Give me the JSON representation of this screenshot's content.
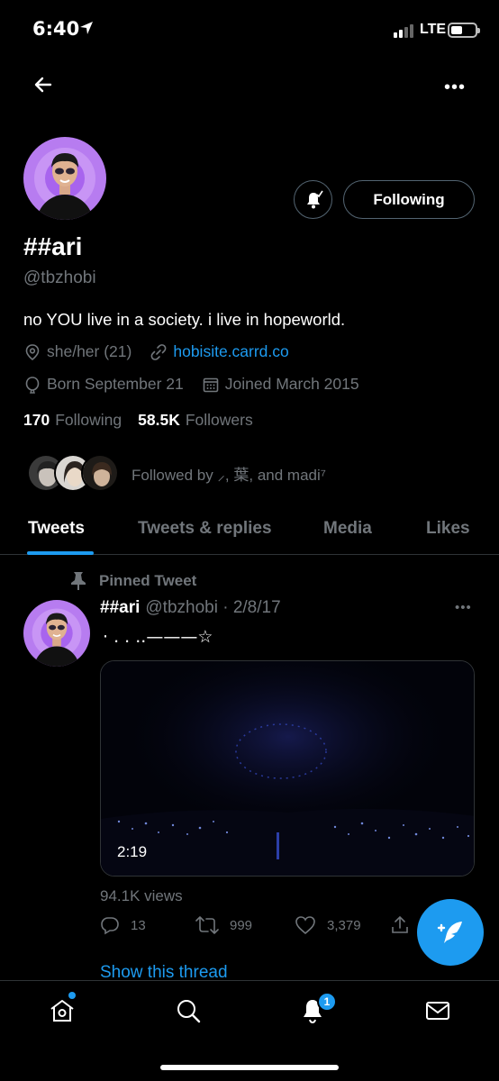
{
  "status_bar": {
    "time": "6:40",
    "network": "LTE"
  },
  "profile": {
    "display_name": "##ari",
    "handle": "@tbzhobi",
    "bio": "no YOU live in a society. i live in hopeworld.",
    "pronouns": "she/her (21)",
    "website": "hobisite.carrd.co",
    "birthday": "Born September 21",
    "joined": "Joined March 2015",
    "following_count": "170",
    "following_label": "Following",
    "followers_count": "58.5K",
    "followers_label": "Followers",
    "followed_by": "Followed by ⸝, 葉, and  madi⁷",
    "follow_button": "Following"
  },
  "tabs": [
    {
      "label": "Tweets",
      "active": true
    },
    {
      "label": "Tweets & replies",
      "active": false
    },
    {
      "label": "Media",
      "active": false
    },
    {
      "label": "Likes",
      "active": false
    }
  ],
  "pinned_tweet": {
    "pinned_label": "Pinned Tweet",
    "author_name": "##ari",
    "author_meta": "@tbzhobi · 2/8/17",
    "text": "· . . ..———☆",
    "video_duration": "2:19",
    "views": "94.1K views",
    "replies": "13",
    "retweets": "999",
    "likes": "3,379",
    "show_thread": "Show this thread"
  },
  "bottom_nav": {
    "notification_badge": "1"
  },
  "colors": {
    "accent": "#1d9bf0",
    "background": "#000000",
    "muted": "#71767b",
    "avatar_bg": "#b77cf0"
  }
}
